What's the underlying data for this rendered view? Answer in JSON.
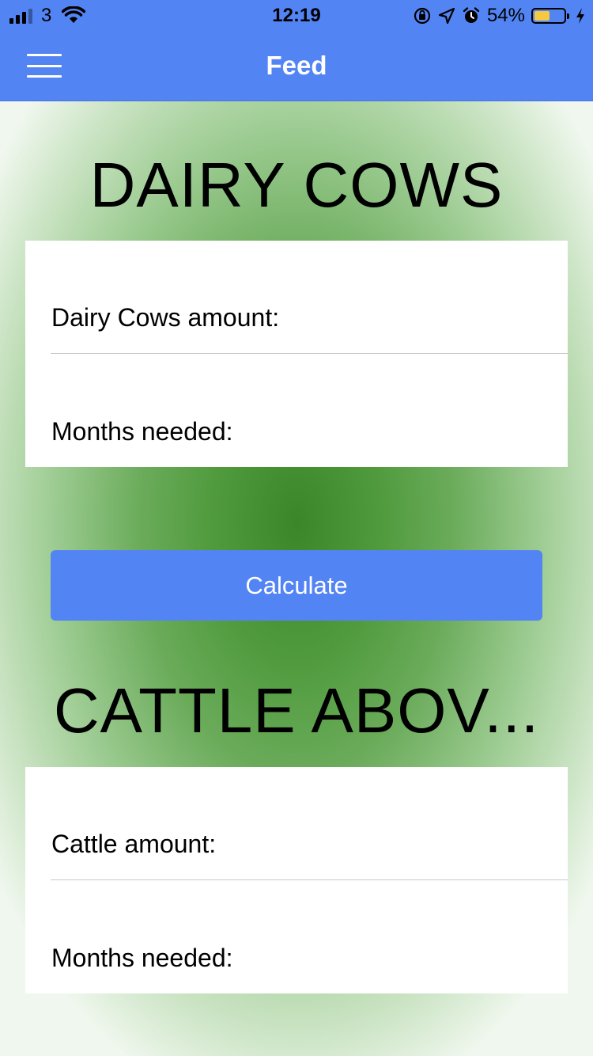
{
  "status_bar": {
    "carrier": "3",
    "time": "12:19",
    "battery_percent_label": "54%",
    "battery_level": 0.54,
    "icons": [
      "signal-icon",
      "wifi-icon",
      "orientation-lock-icon",
      "location-arrow-icon",
      "alarm-icon",
      "battery-icon",
      "charging-bolt-icon"
    ]
  },
  "nav": {
    "title": "Feed",
    "menu_icon": "hamburger-menu-icon"
  },
  "sections": [
    {
      "title": "DAIRY COWS",
      "fields": [
        {
          "label": "Dairy Cows amount:",
          "value": ""
        },
        {
          "label": "Months needed:",
          "value": ""
        }
      ]
    },
    {
      "title": "CATTLE ABOV...",
      "fields": [
        {
          "label": "Cattle amount:",
          "value": ""
        },
        {
          "label": "Months needed:",
          "value": ""
        }
      ]
    }
  ],
  "calculate_button": {
    "label": "Calculate"
  },
  "colors": {
    "header_blue": "#5384f4",
    "button_blue": "#5384f4",
    "background_green_center": "#3a8628",
    "card_white": "#ffffff"
  }
}
